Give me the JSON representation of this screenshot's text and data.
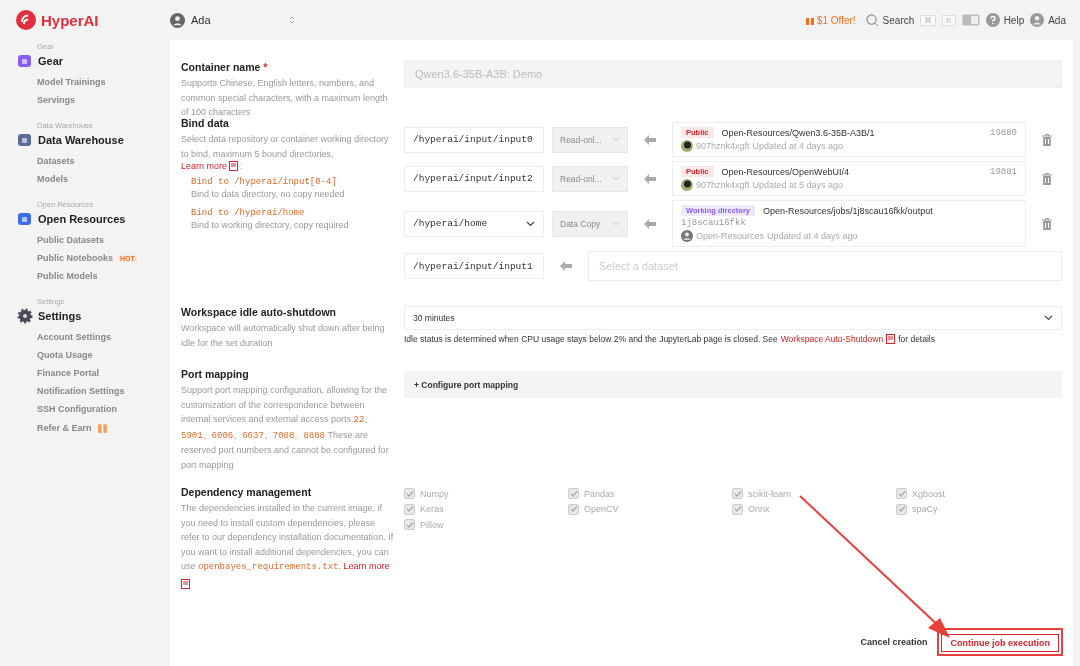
{
  "brand": {
    "name": "HyperAI"
  },
  "workspace_switcher": {
    "name": "Ada"
  },
  "topbar": {
    "offer": "$1 Offer!",
    "search": "Search",
    "keys": [
      "⌘",
      "K"
    ],
    "help": "Help",
    "user": "Ada"
  },
  "sidebar": {
    "groups": [
      {
        "caption": "Gear",
        "title": "Gear",
        "kind": "gear",
        "items": [
          {
            "label": "Model Trainings"
          },
          {
            "label": "Servings"
          }
        ]
      },
      {
        "caption": "Data Warehouse",
        "title": "Data Warehouse",
        "kind": "data",
        "items": [
          {
            "label": "Datasets"
          },
          {
            "label": "Models"
          }
        ]
      },
      {
        "caption": "Open Resources",
        "title": "Open Resources",
        "kind": "open",
        "items": [
          {
            "label": "Public Datasets"
          },
          {
            "label": "Public Notebooks",
            "badge": "HOT"
          },
          {
            "label": "Public Models"
          }
        ]
      },
      {
        "caption": "Settings",
        "title": "Settings",
        "kind": "settings",
        "items": [
          {
            "label": "Account Settings"
          },
          {
            "label": "Quota Usage"
          },
          {
            "label": "Finance Portal"
          },
          {
            "label": "Notification Settings"
          },
          {
            "label": "SSH Configuration"
          },
          {
            "label": "Refer & Earn",
            "gift": true
          }
        ]
      }
    ]
  },
  "container_name": {
    "title": "Container name",
    "required_mark": "*",
    "description": "Supports Chinese, English letters, numbers, and common special characters, with a maximum length of 100 characters",
    "placeholder": "Qwen3.6-35B-A3B: Demo"
  },
  "bind_data": {
    "title": "Bind data",
    "description": "Select data repository or container working directory to bind, maximum 5 bound directories,",
    "learn_more": "Learn more",
    "colon": ":",
    "rules": [
      {
        "path": "Bind to /hyperai/input[0-4]",
        "note": "Bind to data directory, no copy needed"
      },
      {
        "path": "Bind to /hyperai/home",
        "note": "Bind to working directory, copy required"
      }
    ],
    "rows": [
      {
        "path": "/hyperai/input/input0",
        "mode": "Read-onl...",
        "dataset": {
          "tag": "Public",
          "kind": "public",
          "name": "Open-Resources/Qwen3.6-35B-A3B/1",
          "number": "19880",
          "owner": "907hznk4xgft",
          "updated": "Updated at 4 days ago"
        }
      },
      {
        "path": "/hyperai/input/input2",
        "mode": "Read-onl...",
        "dataset": {
          "tag": "Public",
          "kind": "public",
          "name": "Open-Resources/OpenWebUI/4",
          "number": "19881",
          "owner": "907hznk4xgft",
          "updated": "Updated at 5 days ago"
        }
      },
      {
        "path": "/hyperai/home",
        "mode": "Data Copy",
        "dataset": {
          "tag": "Working directory",
          "kind": "working",
          "name": "Open-Resources/jobs/1j8scau16fkk/output",
          "code": "1j8scau16fkk",
          "owner": "Open-Resources",
          "updated": "Updated at 4 days ago"
        }
      },
      {
        "path": "/hyperai/input/input1",
        "placeholder": "Select a dataset"
      }
    ]
  },
  "idle_shutdown": {
    "title": "Workspace idle auto-shutdown",
    "description": "Workspace will automatically shut down after being idle for the set duration",
    "value": "30 minutes",
    "note_before": "Idle status is determined when CPU usage stays below 2% and the JupyterLab page is closed. See",
    "link": "Workspace Auto-Shutdown",
    "note_after": "for details"
  },
  "port_mapping": {
    "title": "Port mapping",
    "description": "Support port mapping configuration, allowing for the customization of the correspondence between internal services and external access ports.",
    "ports": "22、5901、6006、6637、7088、8888",
    "note": "These are reserved port numbers and cannot be configured for port mapping",
    "button": "+ Configure port mapping"
  },
  "dependencies": {
    "title": "Dependency management",
    "description": "The dependencies installed in the current image, if you need to install custom dependencies, please refer to our dependency installation documentation. If you want to install additional dependencies, you can use",
    "file": "openbayes_requirements.txt",
    "period": ".",
    "learn_more": "Learn more",
    "packages": [
      {
        "label": "Numpy",
        "checked": true,
        "disabled": true
      },
      {
        "label": "Pandas",
        "checked": true,
        "disabled": true
      },
      {
        "label": "scikit-learn",
        "checked": true,
        "disabled": true
      },
      {
        "label": "Xgboost",
        "checked": true,
        "disabled": true
      },
      {
        "label": "Keras",
        "checked": true,
        "disabled": true
      },
      {
        "label": "OpenCV",
        "checked": true,
        "disabled": true
      },
      {
        "label": "Onnx",
        "checked": true,
        "disabled": true
      },
      {
        "label": "spaCy",
        "checked": true,
        "disabled": true
      },
      {
        "label": "Pillow",
        "checked": true,
        "disabled": true
      }
    ]
  },
  "footer": {
    "cancel": "Cancel creation",
    "submit": "Continue job execution"
  }
}
